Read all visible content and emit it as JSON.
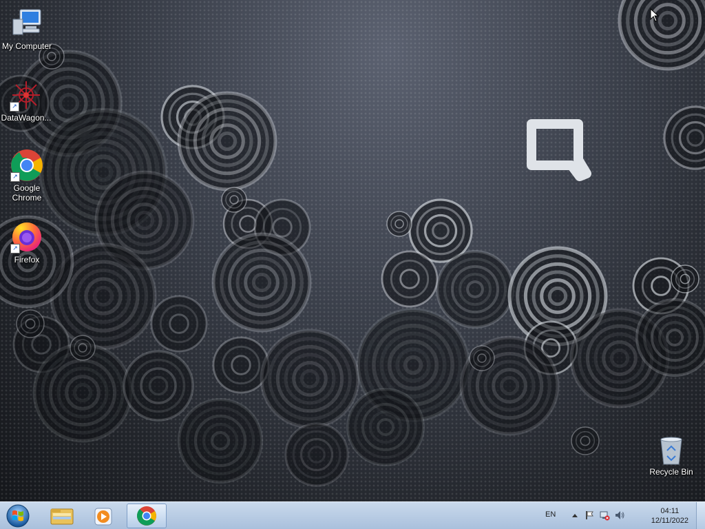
{
  "desktop": {
    "icons": [
      {
        "label": "My Computer",
        "icon": "computer-icon",
        "shortcut": false
      },
      {
        "label": "DataWagon...",
        "icon": "datawagon-icon",
        "shortcut": true
      },
      {
        "label": "Google Chrome",
        "icon": "chrome-icon",
        "shortcut": true
      },
      {
        "label": "Firefox",
        "icon": "firefox-icon",
        "shortcut": true
      },
      {
        "label": "Recycle Bin",
        "icon": "recycle-bin-icon",
        "shortcut": false
      }
    ],
    "shortcut_glyph": "↗"
  },
  "taskbar": {
    "pinned": [
      {
        "name": "Windows Explorer",
        "icon": "folder-icon"
      },
      {
        "name": "Windows Media Player",
        "icon": "media-player-icon"
      },
      {
        "name": "Google Chrome",
        "icon": "chrome-icon",
        "active": true
      }
    ],
    "tray": {
      "language": "EN",
      "time": "04:11",
      "date": "12/11/2022"
    }
  },
  "colors": {
    "taskbar_top": "#c9d9ec",
    "taskbar_bottom": "#a9c0dc"
  }
}
